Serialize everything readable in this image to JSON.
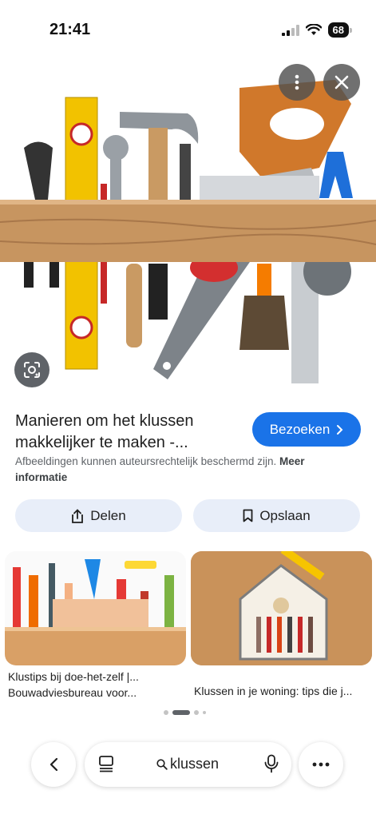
{
  "status_bar": {
    "time": "21:41",
    "battery": "68"
  },
  "result": {
    "title": "Manieren om het klussen makkelijker te maken -...",
    "visit_label": "Bezoeken",
    "copyright_text": "Afbeeldingen kunnen auteursrechtelijk beschermd zijn.",
    "more_info_label": "Meer informatie"
  },
  "actions": {
    "share_label": "Delen",
    "save_label": "Opslaan"
  },
  "related": [
    {
      "line1": "Klustips bij doe-het-zelf |...",
      "line2": "Bouwadviesbureau voor..."
    },
    {
      "line1": "Klussen in je woning: tips die j..."
    }
  ],
  "bottom_bar": {
    "query": "klussen"
  },
  "colors": {
    "accent": "#1a73e8",
    "button_bg": "#e8eef9",
    "text_secondary": "#5f6368"
  },
  "icons": [
    "more-vert-icon",
    "close-icon",
    "lens-icon",
    "chevron-right-icon",
    "share-icon",
    "bookmark-icon",
    "back-icon",
    "tabs-icon",
    "search-icon",
    "mic-icon",
    "more-horiz-icon"
  ]
}
